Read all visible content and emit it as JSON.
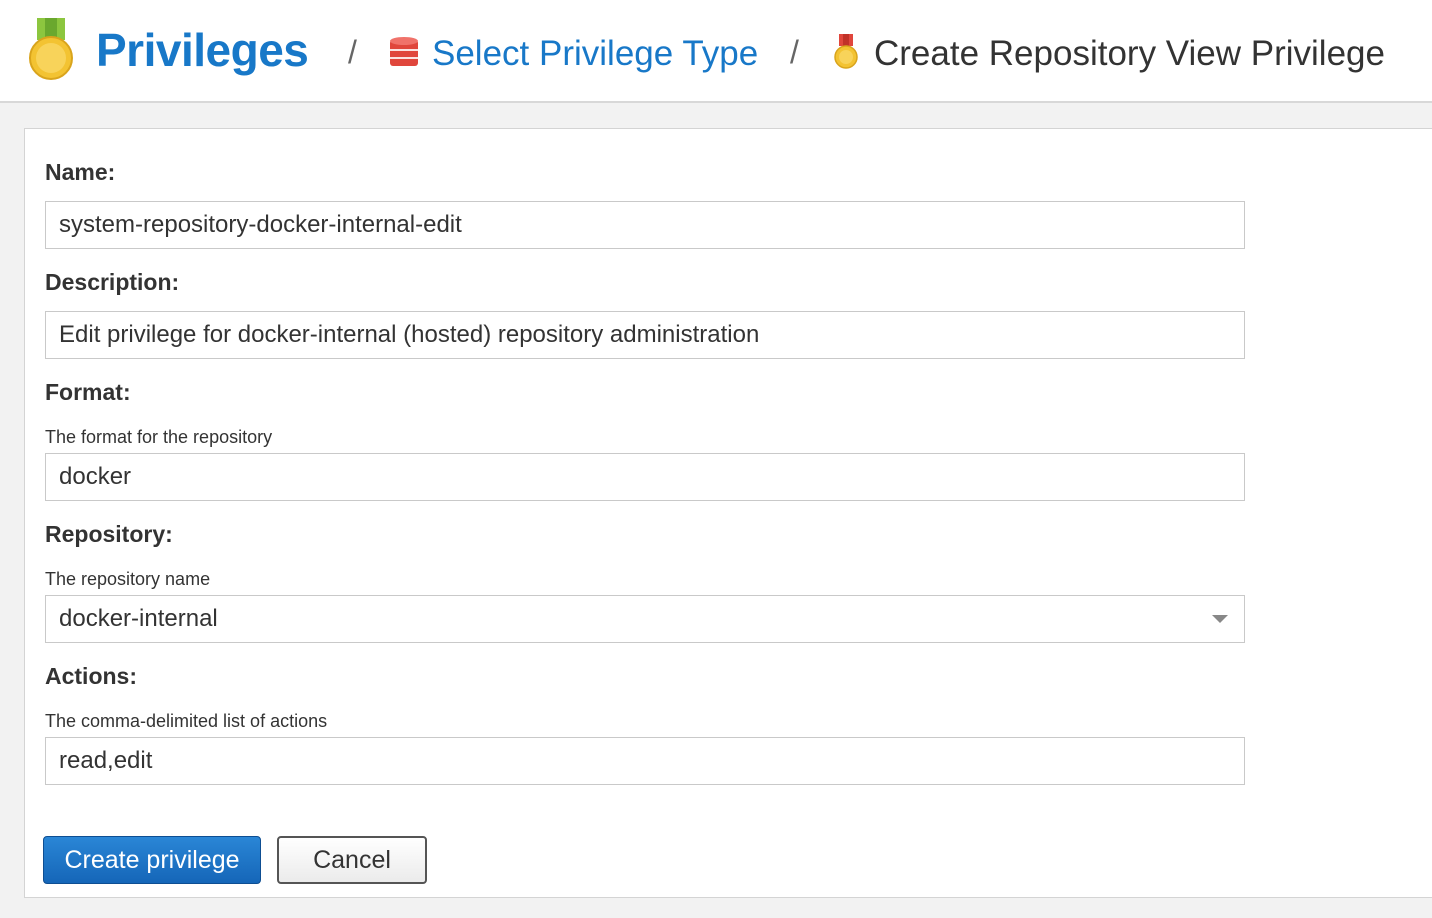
{
  "breadcrumb": {
    "root_label": "Privileges",
    "separator": "/",
    "step_label": "Select Privilege Type",
    "current_label": "Create Repository View Privilege",
    "root_icon": "medal-icon",
    "step_icon": "database-icon",
    "current_icon": "medal-icon"
  },
  "form": {
    "name": {
      "label": "Name:",
      "value": "system-repository-docker-internal-edit"
    },
    "description": {
      "label": "Description:",
      "value": "Edit privilege for docker-internal (hosted) repository administration"
    },
    "format": {
      "label": "Format:",
      "help": "The format for the repository",
      "value": "docker"
    },
    "repository": {
      "label": "Repository:",
      "help": "The repository name",
      "value": "docker-internal"
    },
    "actions": {
      "label": "Actions:",
      "help": "The comma-delimited list of actions",
      "value": "read,edit"
    }
  },
  "buttons": {
    "create_label": "Create privilege",
    "cancel_label": "Cancel"
  },
  "colors": {
    "accent": "#1878c8",
    "primary_button": "#1a6fc4",
    "medal_gold": "#f3c332",
    "medal_ribbon": "#8cc63f",
    "database_red": "#e0463c"
  }
}
